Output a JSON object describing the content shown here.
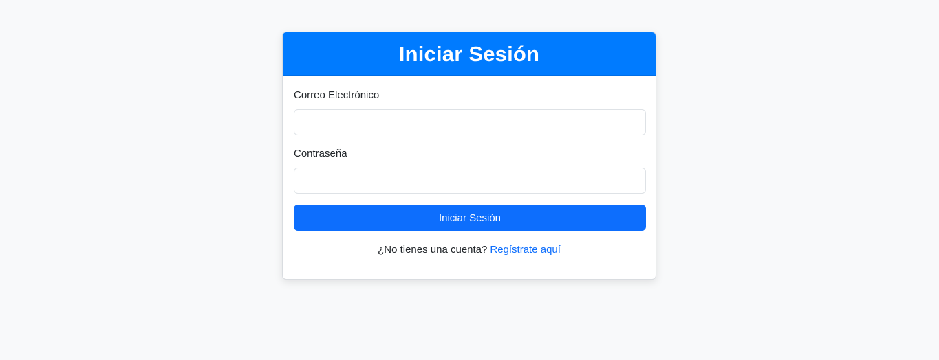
{
  "login": {
    "title": "Iniciar Sesión",
    "email_label": "Correo Electrónico",
    "email_value": "",
    "password_label": "Contraseña",
    "password_value": "",
    "submit_label": "Iniciar Sesión",
    "register_prompt": "¿No tienes una cuenta?",
    "register_link": "Regístrate aquí"
  },
  "colors": {
    "page_background": "#f8f9fa",
    "header_background": "#007bff",
    "button_background": "#0d6efd",
    "link": "#0d6efd"
  }
}
